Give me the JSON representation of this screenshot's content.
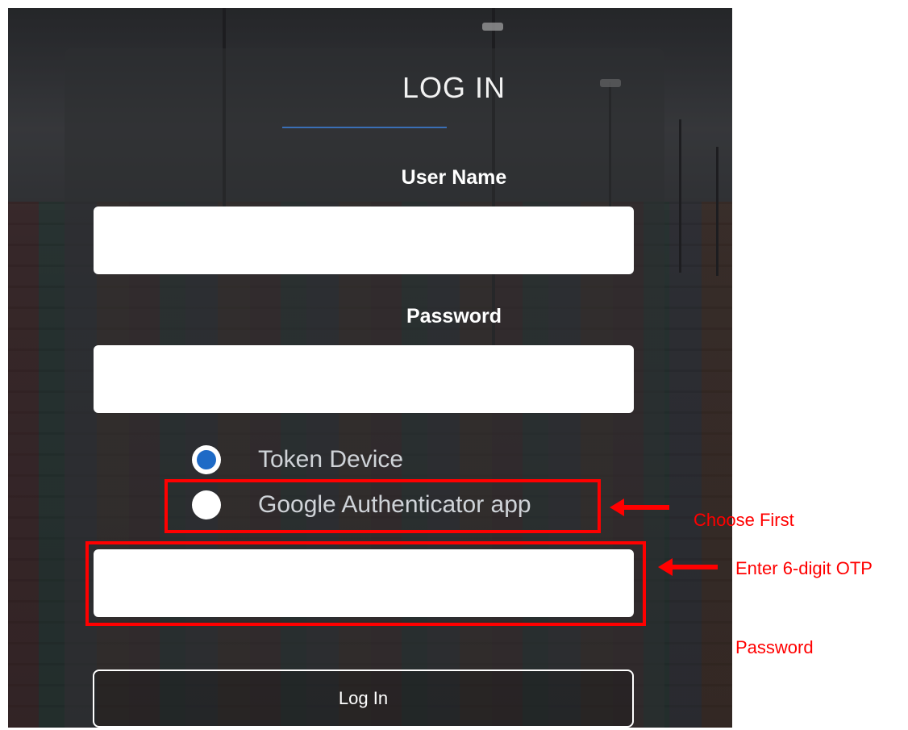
{
  "login": {
    "title": "LOG IN",
    "username_label": "User Name",
    "username_value": "",
    "password_label": "Password",
    "password_value": "",
    "auth_options": [
      {
        "label": "Token Device",
        "selected": true
      },
      {
        "label": "Google Authenticator app",
        "selected": false
      }
    ],
    "otp_value": "",
    "login_button": "Log In"
  },
  "annotations": {
    "choose_first": "Choose First",
    "enter_otp_line1": "Enter 6-digit OTP",
    "enter_otp_line2": "Password"
  },
  "colors": {
    "accent": "#1e6ac6",
    "annotation": "#ff0000",
    "title_underline": "#3a6fb6"
  }
}
